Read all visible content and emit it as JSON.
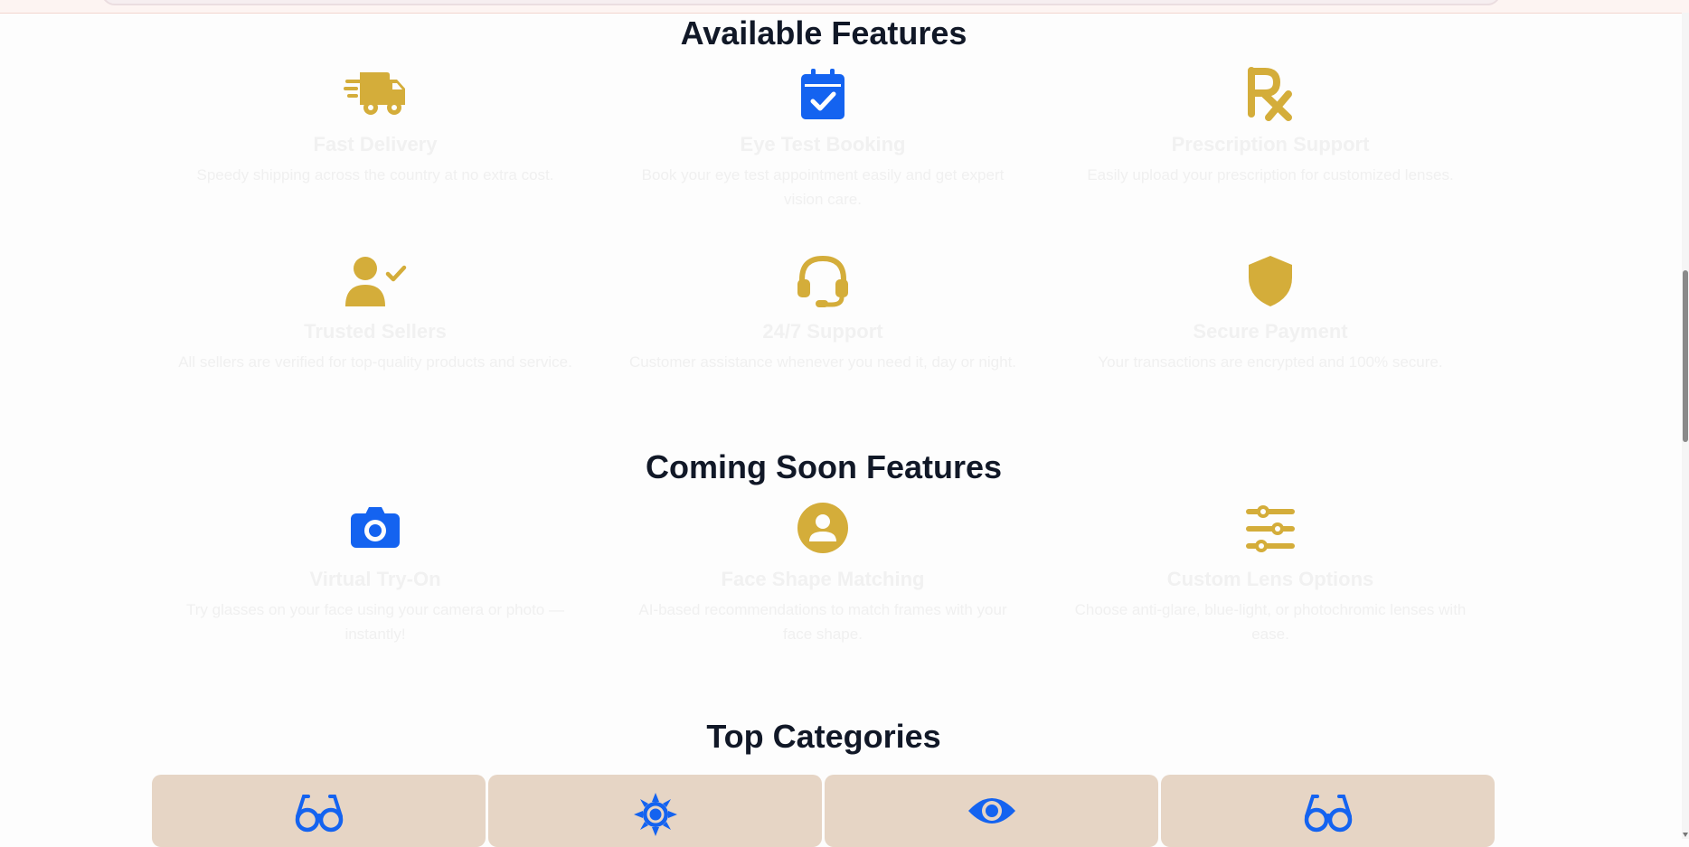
{
  "available": {
    "title": "Available Features",
    "items": [
      {
        "icon": "truck-icon",
        "title": "Fast Delivery",
        "desc": "Speedy shipping across the country at no extra cost."
      },
      {
        "icon": "calendar-check-icon",
        "title": "Eye Test Booking",
        "desc": "Book your eye test appointment easily and get expert vision care."
      },
      {
        "icon": "prescription-icon",
        "title": "Prescription Support",
        "desc": "Easily upload your prescription for customized lenses."
      },
      {
        "icon": "user-check-icon",
        "title": "Trusted Sellers",
        "desc": "All sellers are verified for top-quality products and service."
      },
      {
        "icon": "headset-icon",
        "title": "24/7 Support",
        "desc": "Customer assistance whenever you need it, day or night."
      },
      {
        "icon": "shield-icon",
        "title": "Secure Payment",
        "desc": "Your transactions are encrypted and 100% secure."
      }
    ]
  },
  "coming_soon": {
    "title": "Coming Soon Features",
    "items": [
      {
        "icon": "camera-icon",
        "title": "Virtual Try-On",
        "desc": "Try glasses on your face using your camera or photo — instantly!"
      },
      {
        "icon": "user-circle-icon",
        "title": "Face Shape Matching",
        "desc": "AI-based recommendations to match frames with your face shape."
      },
      {
        "icon": "sliders-icon",
        "title": "Custom Lens Options",
        "desc": "Choose anti-glare, blue-light, or photochromic lenses with ease."
      }
    ]
  },
  "categories": {
    "title": "Top Categories",
    "items": [
      {
        "icon": "glasses-icon"
      },
      {
        "icon": "sun-icon"
      },
      {
        "icon": "eye-icon"
      },
      {
        "icon": "glasses-icon"
      }
    ]
  },
  "colors": {
    "gold": "#d4ad3a",
    "blue": "#1463f0",
    "card": "#e6d5c5",
    "heading": "#111827"
  }
}
